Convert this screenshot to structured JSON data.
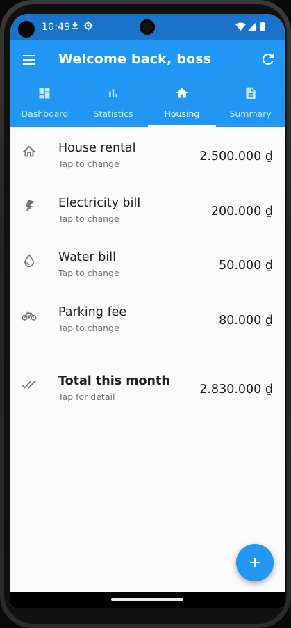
{
  "status_bar": {
    "time": "10:49",
    "icons": [
      "notification-icon",
      "settings-icon",
      "wifi-icon",
      "signal-icon",
      "battery-icon"
    ]
  },
  "app_bar": {
    "title": "Welcome back, boss",
    "background": "#2196f3",
    "tabs": [
      {
        "label": "Dashboard",
        "icon": "dashboard-icon",
        "selected": false
      },
      {
        "label": "Statistics",
        "icon": "bar-chart-icon",
        "selected": false
      },
      {
        "label": "Housing",
        "icon": "home-icon",
        "selected": true
      },
      {
        "label": "Summary",
        "icon": "document-icon",
        "selected": false
      }
    ]
  },
  "expenses": [
    {
      "title": "House rental",
      "subtitle": "Tap to change",
      "amount": "2.500.000 ₫",
      "icon": "house-icon"
    },
    {
      "title": "Electricity bill",
      "subtitle": "Tap to change",
      "amount": "200.000 ₫",
      "icon": "bolt-icon"
    },
    {
      "title": "Water bill",
      "subtitle": "Tap to change",
      "amount": "50.000 ₫",
      "icon": "water-drop-icon"
    },
    {
      "title": "Parking fee",
      "subtitle": "Tap to change",
      "amount": "80.000 ₫",
      "icon": "bicycle-icon"
    }
  ],
  "total": {
    "title": "Total this month",
    "subtitle": "Tap for detail",
    "amount": "2.830.000 ₫",
    "icon": "double-check-icon"
  },
  "fab": {
    "icon": "add-icon",
    "color": "#2196f3"
  }
}
